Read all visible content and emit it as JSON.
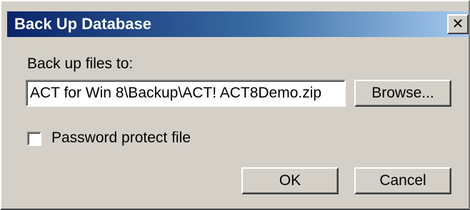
{
  "window": {
    "title": "Back Up Database",
    "close_glyph": "✕"
  },
  "backup": {
    "label": "Back up files to:",
    "path_value": "ACT for Win 8\\Backup\\ACT! ACT8Demo.zip",
    "browse_label": "Browse..."
  },
  "password": {
    "label": "Password protect file",
    "checked": false
  },
  "buttons": {
    "ok_label": "OK",
    "cancel_label": "Cancel"
  }
}
